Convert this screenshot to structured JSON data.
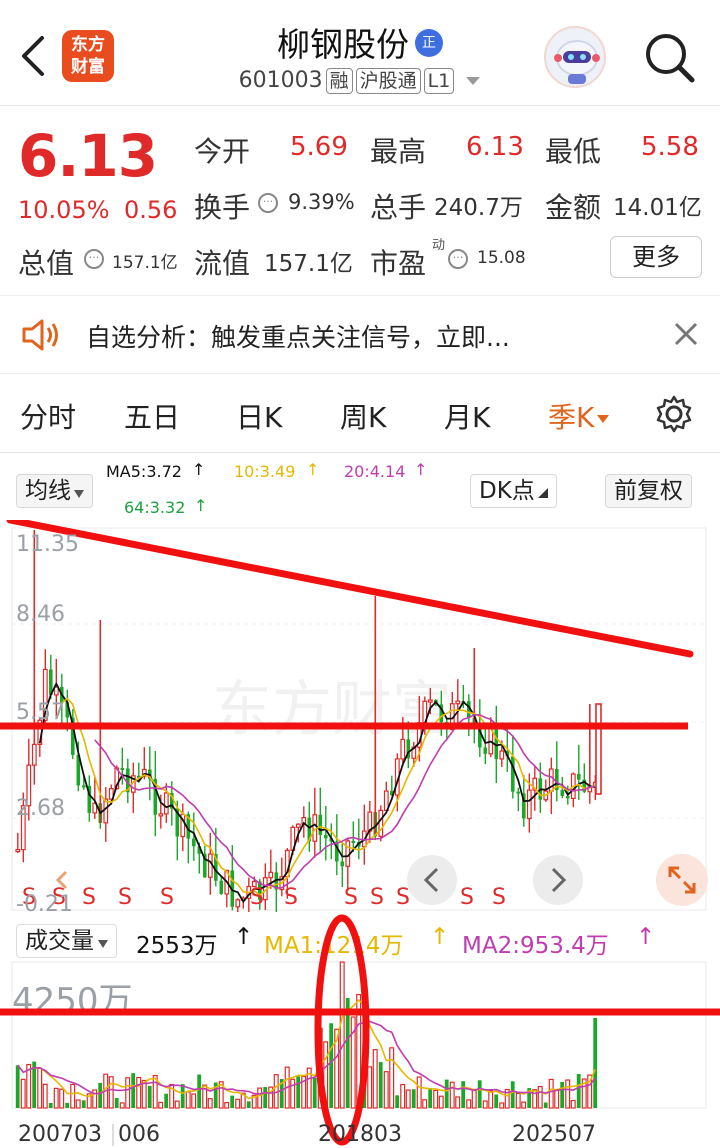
{
  "header": {
    "title": "柳钢股份",
    "title_badge": "正",
    "code": "601003",
    "tag_margin": "融",
    "tag_connect": "沪股通",
    "tag_level": "L1",
    "logo_line1": "东方",
    "logo_line2": "财富"
  },
  "quote": {
    "price": "6.13",
    "change_pct": "10.05%",
    "change": "0.56",
    "open_label": "今开",
    "open": "5.69",
    "high_label": "最高",
    "high": "6.13",
    "low_label": "最低",
    "low": "5.58",
    "turnover_label": "换手",
    "turnover": "9.39%",
    "volume_label": "总手",
    "volume": "240.7万",
    "amount_label": "金额",
    "amount": "14.01亿",
    "mktcap_label": "总值",
    "mktcap": "157.1亿",
    "float_label": "流值",
    "float_cap": "157.1亿",
    "pe_label": "市盈",
    "pe_sup": "动",
    "pe": "15.08",
    "more_button": "更多"
  },
  "notice": {
    "text": "自选分析：触发重点关注信号，立即..."
  },
  "tabs": [
    "分时",
    "五日",
    "日K",
    "周K",
    "月K",
    "季K"
  ],
  "chart_toolbar": {
    "ma_select": "均线",
    "ma5": "MA5:3.72",
    "ma10": "10:3.49",
    "ma20": "20:4.14",
    "ma64": "64:3.32",
    "dk_button": "DK点",
    "adjust_button": "前复权"
  },
  "price_axis": [
    "11.35",
    "8.46",
    "5.57",
    "2.68",
    "-0.21"
  ],
  "signal_marker": "S",
  "volume_bar": {
    "select": "成交量",
    "value": "2553万",
    "ma1": "MA1:1214万",
    "ma2": "MA2:953.4万"
  },
  "volume_axis_max": "4250万",
  "dates": [
    "200703",
    "006",
    "201803",
    "202507"
  ],
  "colors": {
    "up": "#e02a2a",
    "down": "#1aa82a",
    "accent": "#e0641e",
    "ma5": "#111111",
    "ma10": "#e6b800",
    "ma20": "#c03cb0",
    "ma64": "#20a040"
  },
  "watermark": "东方财富"
}
